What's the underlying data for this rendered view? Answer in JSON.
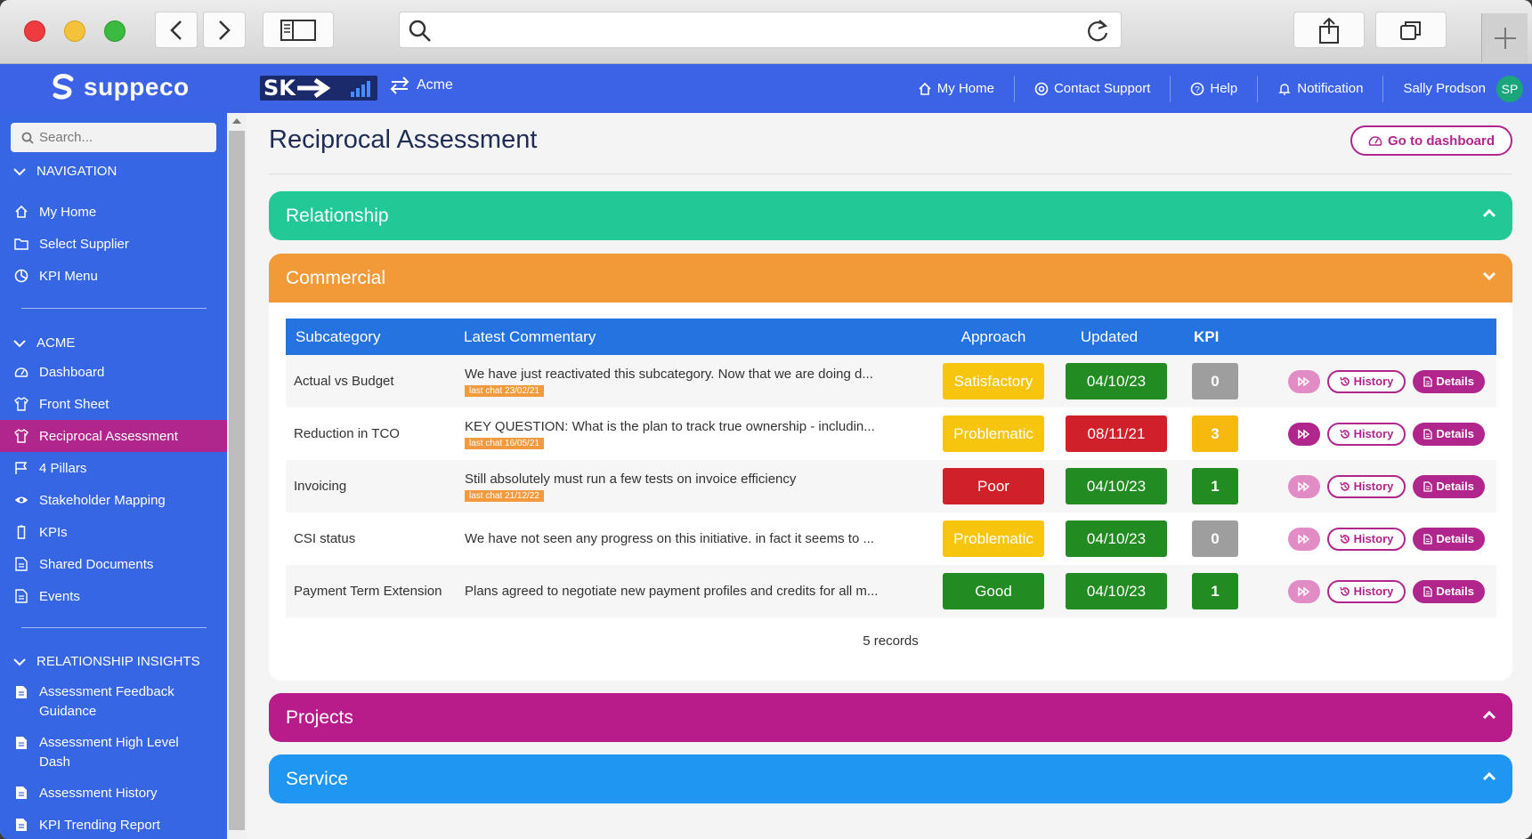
{
  "browser": {
    "icons": [
      "chevron-left-icon",
      "chevron-right-icon",
      "sidebar-icon",
      "search-icon",
      "reload-icon",
      "share-icon",
      "tabs-icon",
      "plus-icon"
    ]
  },
  "header": {
    "brand": "suppeco",
    "sk_logo": "SK",
    "org": "Acme",
    "nav": {
      "home": "My Home",
      "support": "Contact Support",
      "help": "Help",
      "notification": "Notification",
      "user": "Sally Prodson",
      "initials": "SP"
    }
  },
  "sidebar": {
    "search_placeholder": "Search...",
    "sections": [
      {
        "title": "NAVIGATION",
        "items": [
          {
            "label": "My Home",
            "icon": "home-icon"
          },
          {
            "label": "Select Supplier",
            "icon": "folder-icon"
          },
          {
            "label": "KPI Menu",
            "icon": "pie-chart-icon"
          }
        ]
      },
      {
        "title": "ACME",
        "items": [
          {
            "label": "Dashboard",
            "icon": "gauge-icon"
          },
          {
            "label": "Front Sheet",
            "icon": "shirt-icon"
          },
          {
            "label": "Reciprocal Assessment",
            "icon": "shirt-icon",
            "active": true
          },
          {
            "label": "4 Pillars",
            "icon": "flag-icon"
          },
          {
            "label": "Stakeholder Mapping",
            "icon": "eye-icon"
          },
          {
            "label": "KPIs",
            "icon": "battery-icon"
          },
          {
            "label": "Shared Documents",
            "icon": "document-icon"
          },
          {
            "label": "Events",
            "icon": "document-icon"
          }
        ]
      },
      {
        "title": "RELATIONSHIP INSIGHTS",
        "items": [
          {
            "label": "Assessment Feedback Guidance",
            "icon": "report-icon"
          },
          {
            "label": "Assessment High Level Dash",
            "icon": "report-icon"
          },
          {
            "label": "Assessment History",
            "icon": "report-icon"
          },
          {
            "label": "KPI Trending Report",
            "icon": "report-icon"
          }
        ]
      }
    ]
  },
  "main": {
    "title": "Reciprocal Assessment",
    "dashboard_button": "Go to dashboard",
    "panels": {
      "relationship": "Relationship",
      "commercial": "Commercial",
      "projects": "Projects",
      "service": "Service"
    },
    "table": {
      "headers": [
        "Subcategory",
        "Latest Commentary",
        "Approach",
        "Updated",
        "KPI"
      ],
      "history_label": "History",
      "details_label": "Details",
      "rows": [
        {
          "subcategory": "Actual vs Budget",
          "commentary": "We have just reactivated this subcategory. Now that we are doing d...",
          "chat": "last chat 23/02/21",
          "approach": "Satisfactory",
          "approach_color": "#f7c40e",
          "updated": "04/10/23",
          "updated_color": "#228b22",
          "kpi": "0",
          "kpi_color": "#9e9e9e",
          "ff_active": false
        },
        {
          "subcategory": "Reduction in TCO",
          "commentary": "KEY QUESTION: What is the plan to track true ownership - includin...",
          "chat": "last chat 16/05/21",
          "approach": "Problematic",
          "approach_color": "#f7c40e",
          "updated": "08/11/21",
          "updated_color": "#d0202a",
          "kpi": "3",
          "kpi_color": "#f7b90e",
          "ff_active": true
        },
        {
          "subcategory": "Invoicing",
          "commentary": "Still absolutely must run a few tests on invoice efficiency",
          "chat": "last chat 21/12/22",
          "approach": "Poor",
          "approach_color": "#d0202a",
          "updated": "04/10/23",
          "updated_color": "#228b22",
          "kpi": "1",
          "kpi_color": "#228b22",
          "ff_active": false
        },
        {
          "subcategory": "CSI status",
          "commentary": "We have not seen any progress on this initiative. in fact it seems to ...",
          "chat": "",
          "approach": "Problematic",
          "approach_color": "#f7c40e",
          "updated": "04/10/23",
          "updated_color": "#228b22",
          "kpi": "0",
          "kpi_color": "#9e9e9e",
          "ff_active": false
        },
        {
          "subcategory": "Payment Term Extension",
          "commentary": "Plans agreed to negotiate new payment profiles and credits for all m...",
          "chat": "",
          "approach": "Good",
          "approach_color": "#228b22",
          "updated": "04/10/23",
          "updated_color": "#228b22",
          "kpi": "1",
          "kpi_color": "#228b22",
          "ff_active": false
        }
      ],
      "records": "5 records"
    }
  }
}
